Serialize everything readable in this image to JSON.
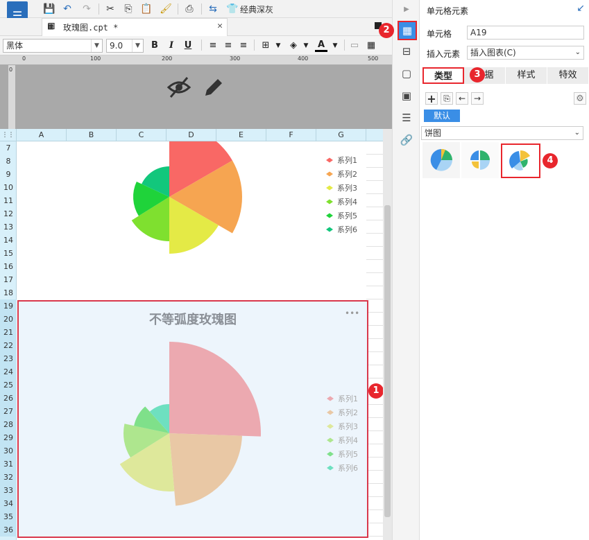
{
  "toolbar": {
    "theme_label": "经典深灰"
  },
  "tab": {
    "filename": "玫瑰图.cpt *"
  },
  "format": {
    "font": "黑体",
    "size": "9.0",
    "bold": "B",
    "italic": "I",
    "underline": "U",
    "font_color": "A"
  },
  "ruler": {
    "marks": [
      "0",
      "100",
      "200",
      "300",
      "400",
      "500"
    ],
    "v_mark": "0"
  },
  "columns": [
    "A",
    "B",
    "C",
    "D",
    "E",
    "F",
    "G"
  ],
  "rows": [
    "7",
    "8",
    "9",
    "10",
    "11",
    "12",
    "13",
    "14",
    "15",
    "16",
    "17",
    "18",
    "19",
    "20",
    "21",
    "22",
    "23",
    "24",
    "25",
    "26",
    "27",
    "28",
    "29",
    "30",
    "31",
    "32",
    "33",
    "34",
    "35",
    "36"
  ],
  "chart1": {
    "legend": [
      "系列1",
      "系列2",
      "系列3",
      "系列4",
      "系列5",
      "系列6"
    ],
    "colors": [
      "#f96865",
      "#f6a551",
      "#e4ea46",
      "#7fe02f",
      "#1fd33a",
      "#12c77c"
    ]
  },
  "chart2": {
    "title": "不等弧度玫瑰图",
    "more": "•••",
    "legend": [
      "系列1",
      "系列2",
      "系列3",
      "系列4",
      "系列5",
      "系列6"
    ],
    "colors": [
      "#eca9b0",
      "#e9c8a5",
      "#dee89b",
      "#aee68e",
      "#7fe08a",
      "#6ee0c0"
    ]
  },
  "panel": {
    "title": "单元格元素",
    "cell_label": "单元格",
    "cell_value": "A19",
    "insert_label": "插入元素",
    "insert_value": "插入图表(C)",
    "tabs": [
      "类型",
      "数据",
      "样式",
      "特效"
    ],
    "default_label": "默认",
    "chart_type": "饼图"
  },
  "badges": [
    "1",
    "2",
    "3",
    "4"
  ]
}
